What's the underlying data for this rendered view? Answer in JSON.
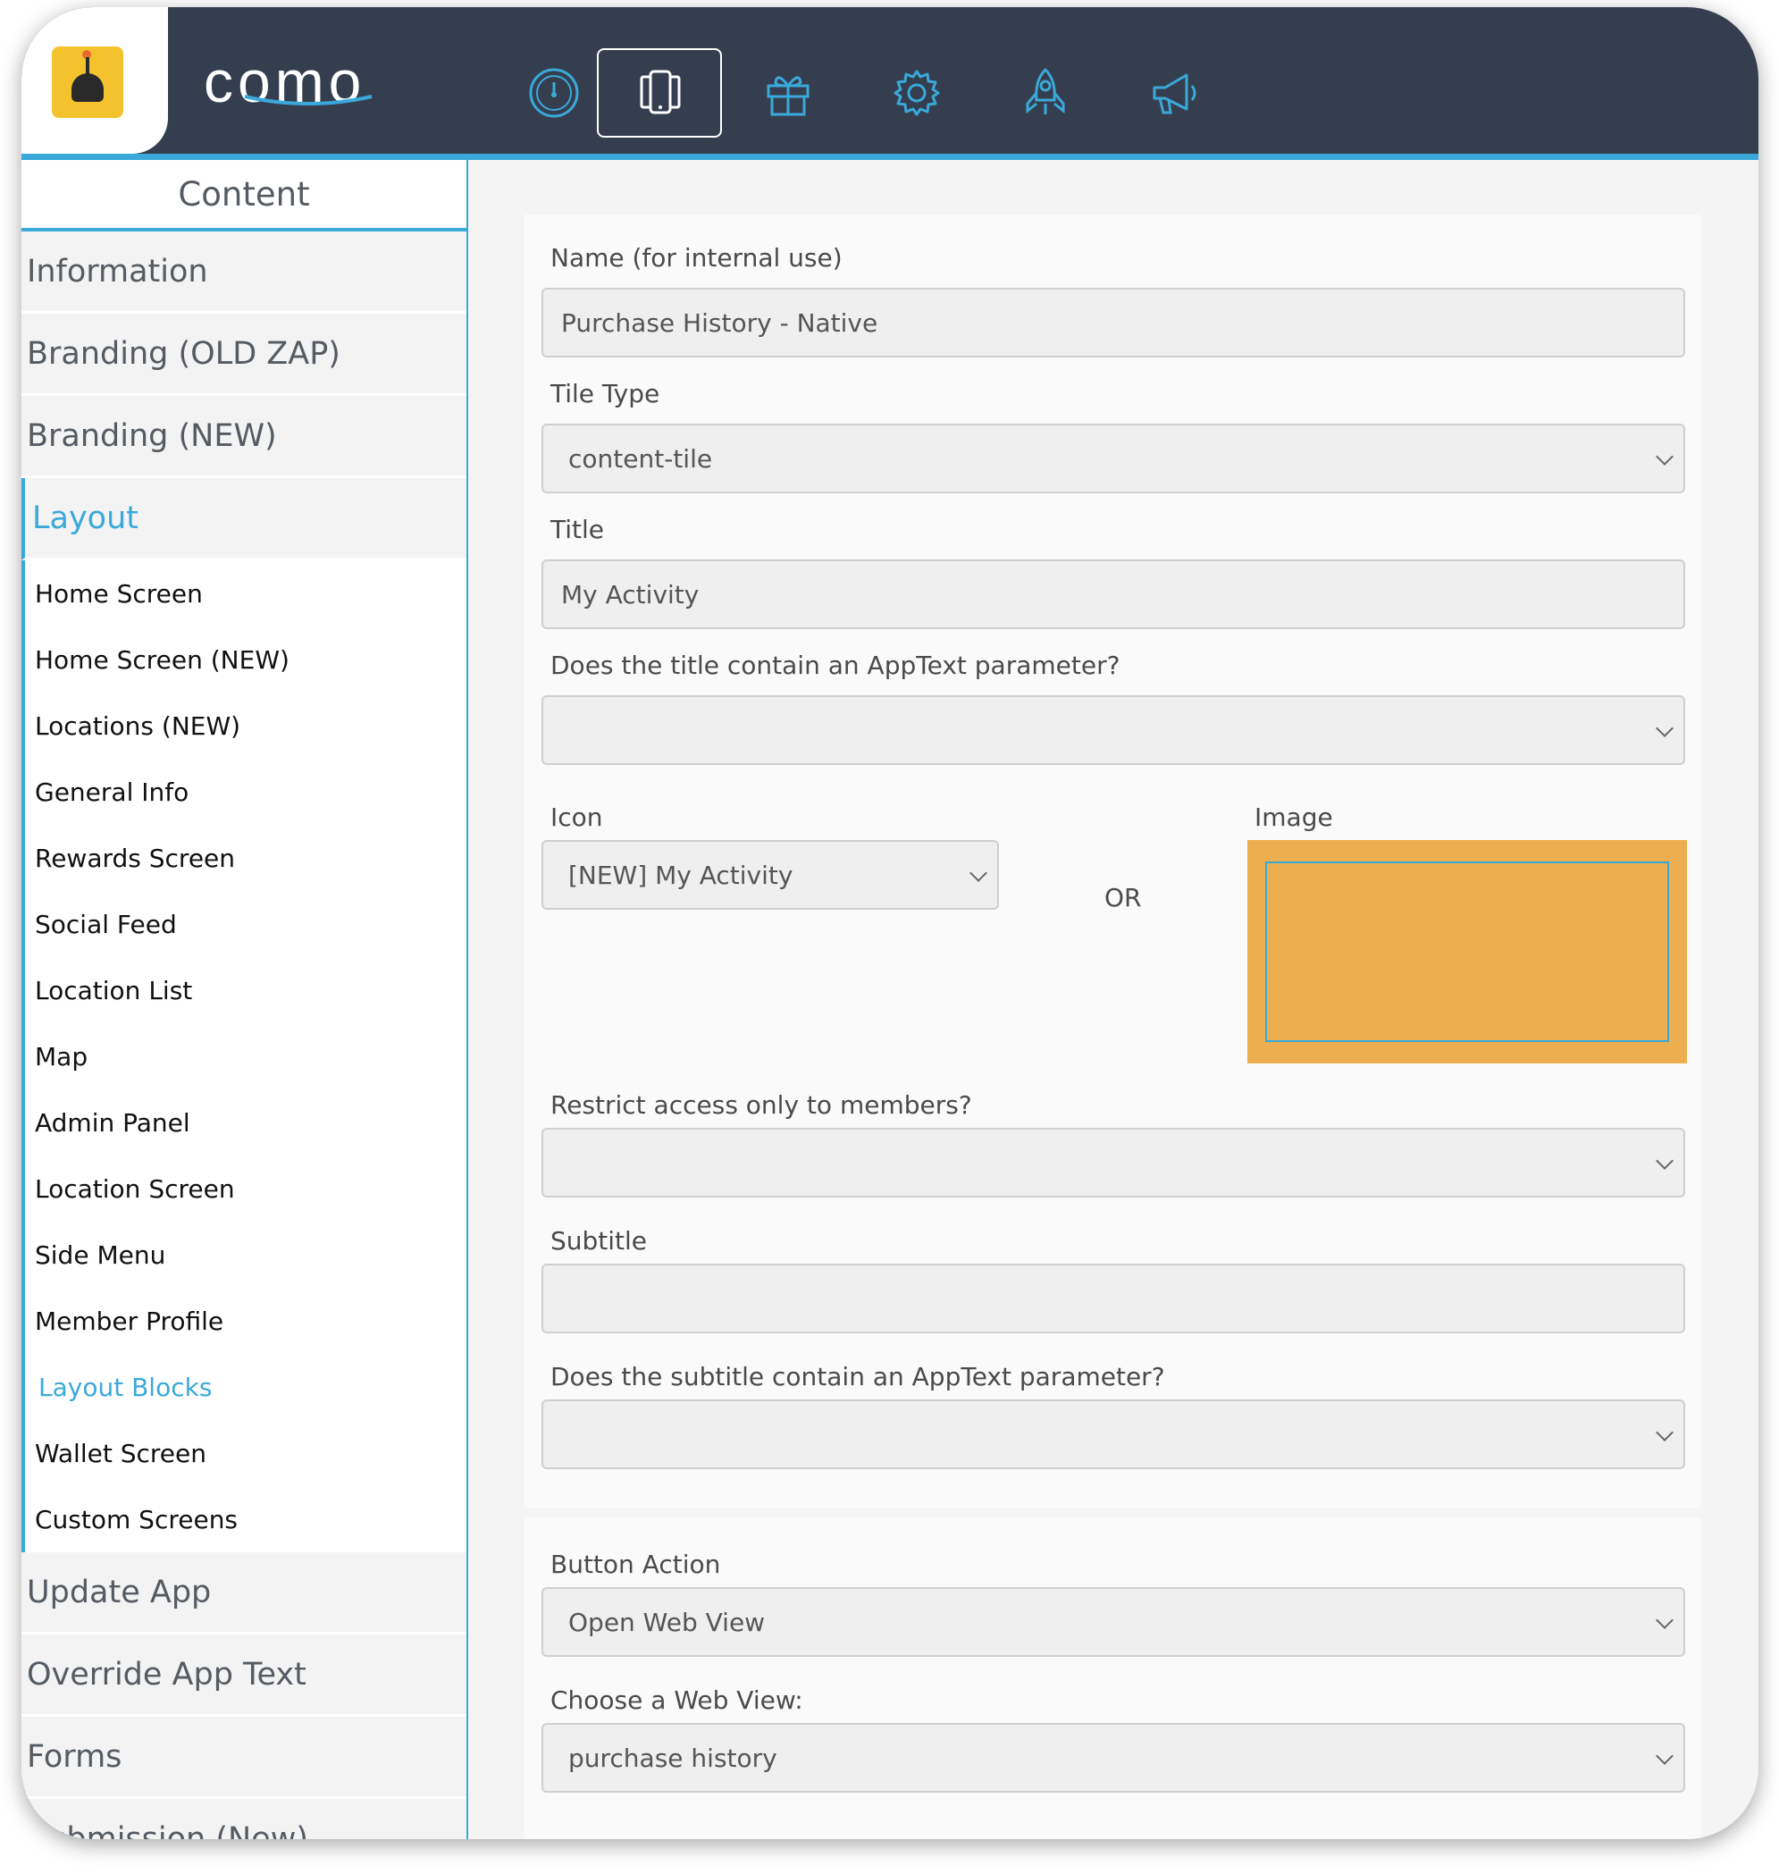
{
  "app": {
    "brand": "como",
    "logo_icon": "burger-logo-icon"
  },
  "nav": [
    {
      "name": "dashboard-icon",
      "active": false
    },
    {
      "name": "app-layout-icon",
      "active": true
    },
    {
      "name": "gift-icon",
      "active": false
    },
    {
      "name": "settings-gear-icon",
      "active": false
    },
    {
      "name": "rocket-icon",
      "active": false
    },
    {
      "name": "megaphone-icon",
      "active": false
    }
  ],
  "sidebar": {
    "title": "Content",
    "sections_top": [
      "Information",
      "Branding (OLD ZAP)",
      "Branding (NEW)"
    ],
    "active_section": "Layout",
    "layout_items": [
      "Home Screen",
      "Home Screen (NEW)",
      "Locations (NEW)",
      "General Info",
      "Rewards Screen",
      "Social Feed",
      "Location List",
      "Map",
      "Admin Panel",
      "Location Screen",
      "Side Menu",
      "Member Profile",
      "Layout Blocks",
      "Wallet Screen",
      "Custom Screens"
    ],
    "active_item": "Layout Blocks",
    "sections_bottom": [
      "Update App",
      "Override App Text",
      "Forms",
      "Submission (New)"
    ]
  },
  "form": {
    "name_label": "Name (for internal use)",
    "name_value": "Purchase History - Native",
    "tile_type_label": "Tile Type",
    "tile_type_value": "content-tile",
    "title_label": "Title",
    "title_value": "My Activity",
    "title_apptext_label": "Does the title contain an AppText parameter?",
    "title_apptext_value": "",
    "icon_label": "Icon",
    "icon_value": "[NEW] My Activity",
    "or_text": "OR",
    "image_label": "Image",
    "image_color": "#ecae4e",
    "restrict_label": "Restrict access only to members?",
    "restrict_value": "",
    "subtitle_label": "Subtitle",
    "subtitle_value": "",
    "subtitle_apptext_label": "Does the subtitle contain an AppText parameter?",
    "subtitle_apptext_value": "",
    "button_action_label": "Button Action",
    "button_action_value": "Open Web View",
    "web_view_label": "Choose a Web View:",
    "web_view_value": "purchase history"
  },
  "colors": {
    "topbar": "#353e4f",
    "accent": "#3aa9d9",
    "logo_bg": "#f3c22d"
  }
}
